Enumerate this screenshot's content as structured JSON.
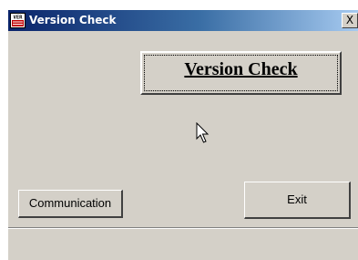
{
  "window": {
    "title": "Version Check",
    "icon": "ver-document-icon",
    "icon_text": "VER",
    "close_label": "X"
  },
  "main": {
    "version_check_label": "Version Check"
  },
  "buttons": {
    "communication_label": "Communication",
    "exit_label": "Exit"
  },
  "colors": {
    "window_bg": "#d4d0c8",
    "title_start": "#0a246a",
    "title_end": "#a6caf0"
  }
}
